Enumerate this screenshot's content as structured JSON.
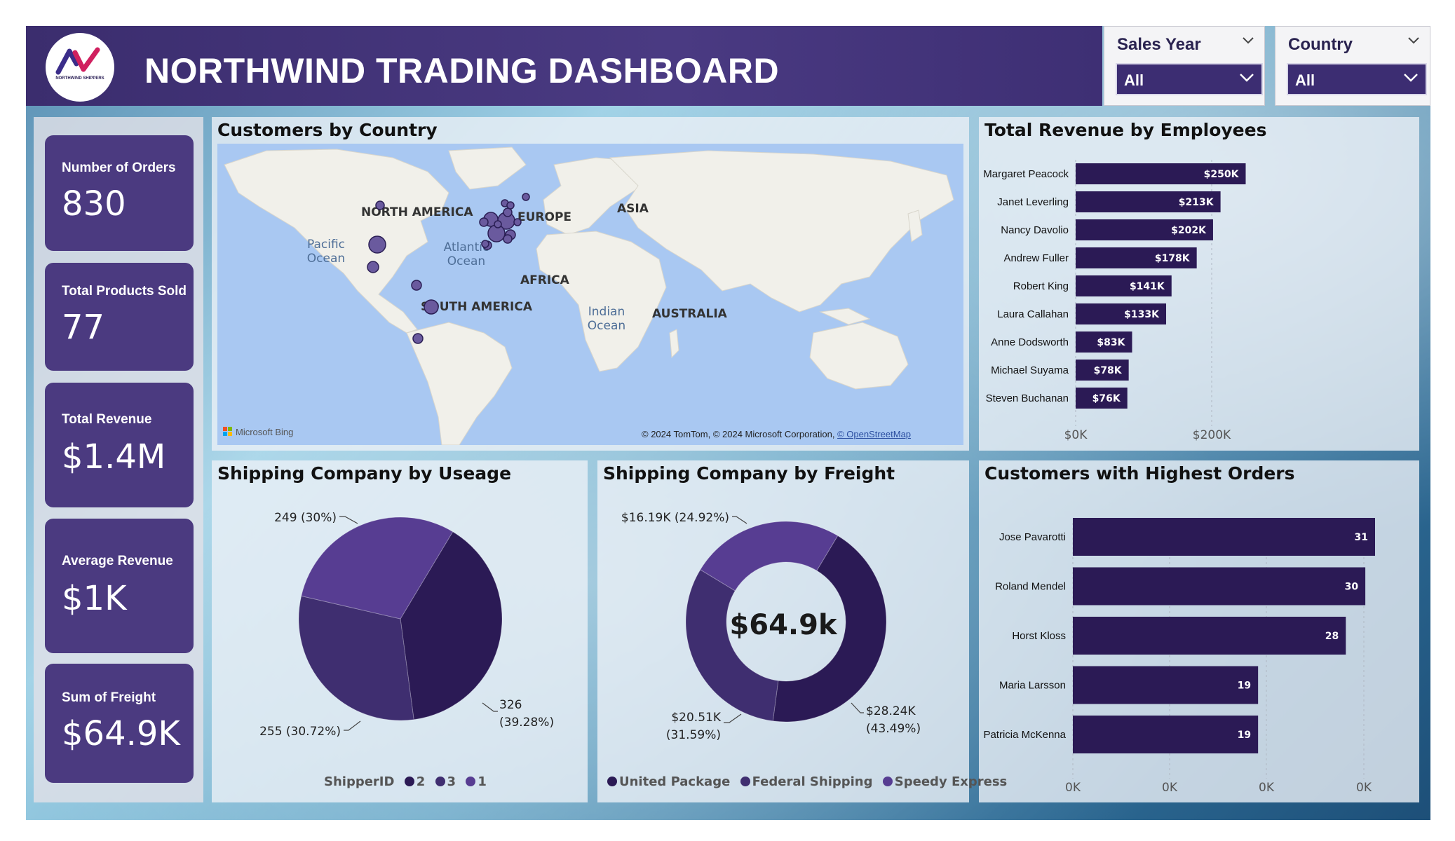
{
  "title": "NORTHWIND TRADING DASHBOARD",
  "logo": {
    "text": "NORTHWIND SHIPPERS"
  },
  "slicers": [
    {
      "title": "Sales Year",
      "value": "All"
    },
    {
      "title": "Country",
      "value": "All"
    }
  ],
  "kpis": [
    {
      "label": "Number of Orders",
      "value": "830"
    },
    {
      "label": "Total Products Sold",
      "value": "77"
    },
    {
      "label": "Total Revenue",
      "value": "$1.4M"
    },
    {
      "label": "Average Revenue",
      "value": "$1K"
    },
    {
      "label": "Sum of Freight",
      "value": "$64.9K"
    }
  ],
  "colors": {
    "dark_purple": "#2b1a55",
    "mid_purple": "#3f2e70",
    "light_purple": "#573d92",
    "kpi_bg": "#4b3a80",
    "header_bg": "#3b2d6e"
  },
  "map": {
    "title": "Customers by Country",
    "continents": [
      "NORTH AMERICA",
      "EUROPE",
      "ASIA",
      "AFRICA",
      "SOUTH AMERICA",
      "AUSTRALIA"
    ],
    "oceans": [
      "Pacific Ocean",
      "Atlantic Ocean",
      "Indian Ocean"
    ],
    "brand": "Microsoft Bing",
    "credit": "© 2024 TomTom, © 2024 Microsoft Corporation,",
    "credit_link": "© OpenStreetMap"
  },
  "chart_data": [
    {
      "type": "bar",
      "orientation": "horizontal",
      "title": "Total Revenue by Employees",
      "categories": [
        "Margaret Peacock",
        "Janet Leverling",
        "Nancy Davolio",
        "Andrew Fuller",
        "Robert King",
        "Laura Callahan",
        "Anne Dodsworth",
        "Michael Suyama",
        "Steven Buchanan"
      ],
      "values": [
        250000,
        213000,
        202000,
        178000,
        141000,
        133000,
        83000,
        78000,
        76000
      ],
      "labels": [
        "$250K",
        "$213K",
        "$202K",
        "$178K",
        "$141K",
        "$133K",
        "$83K",
        "$78K",
        "$76K"
      ],
      "xticks": [
        "$0K",
        "$200K"
      ],
      "xlim": [
        0,
        350000
      ],
      "grid": true
    },
    {
      "type": "pie",
      "title": "Shipping Company by Useage",
      "legend_title": "ShipperID",
      "categories": [
        "2",
        "3",
        "1"
      ],
      "values": [
        326,
        255,
        249
      ],
      "labels": [
        "326\n(39.28%)",
        "255 (30.72%)",
        "249 (30%)"
      ],
      "legend": "bottom"
    },
    {
      "type": "pie",
      "variant": "donut",
      "title": "Shipping Company by Freight",
      "categories": [
        "United Package",
        "Federal Shipping",
        "Speedy Express"
      ],
      "values": [
        28240,
        20510,
        16190
      ],
      "labels": [
        "$28.24K\n(43.49%)",
        "$20.51K\n(31.59%)",
        "$16.19K (24.92%)"
      ],
      "center_label": "$64.9k",
      "legend": "bottom"
    },
    {
      "type": "bar",
      "orientation": "horizontal",
      "title": "Customers with Highest Orders",
      "categories": [
        "Jose Pavarotti",
        "Roland Mendel",
        "Horst Kloss",
        "Maria Larsson",
        "Patricia McKenna"
      ],
      "values": [
        31,
        30,
        28,
        19,
        19
      ],
      "xticks": [
        "0K",
        "0K",
        "0K",
        "0K"
      ],
      "xlim": [
        0,
        34
      ],
      "grid": true
    }
  ]
}
